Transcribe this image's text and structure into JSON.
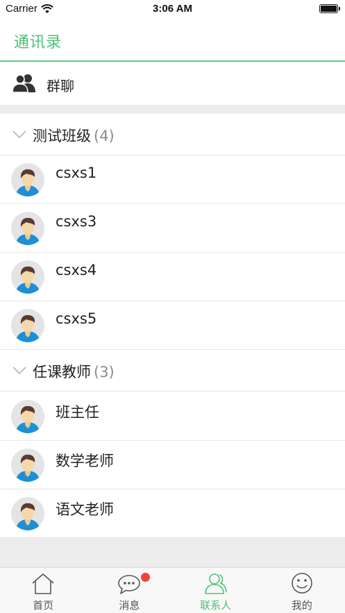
{
  "status_bar": {
    "carrier": "Carrier",
    "time": "3:06 AM"
  },
  "header": {
    "title": "通讯录"
  },
  "group_chat": {
    "label": "群聊",
    "icon": "group-people-icon"
  },
  "sections": [
    {
      "title": "测试班级",
      "count": "(4)",
      "contacts": [
        {
          "name": "csxs1"
        },
        {
          "name": "csxs3"
        },
        {
          "name": "csxs4"
        },
        {
          "name": "csxs5"
        }
      ]
    },
    {
      "title": "任课教师",
      "count": "(3)",
      "contacts": [
        {
          "name": "班主任"
        },
        {
          "name": "数学老师"
        },
        {
          "name": "语文老师"
        }
      ]
    }
  ],
  "tabs": [
    {
      "label": "首页",
      "icon": "home-icon",
      "active": false
    },
    {
      "label": "消息",
      "icon": "message-icon",
      "active": false,
      "has_badge": true
    },
    {
      "label": "联系人",
      "icon": "contacts-icon",
      "active": true
    },
    {
      "label": "我的",
      "icon": "smile-icon",
      "active": false
    }
  ],
  "colors": {
    "accent": "#4cc274",
    "badge": "#f44336",
    "divider_band": "#ededed"
  }
}
